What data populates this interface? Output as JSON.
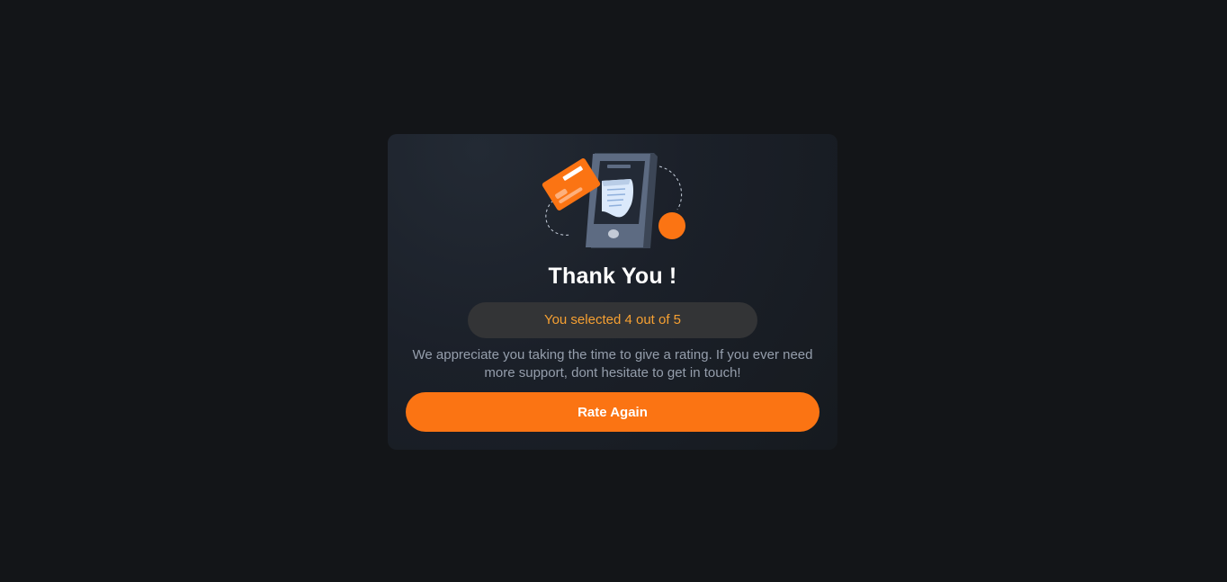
{
  "thank_you": {
    "title": "Thank You !",
    "selection_text": "You selected 4 out of 5",
    "message": "We appreciate you taking the time to give a rating. If you ever need more support, dont hesitate to get in touch!",
    "rate_again_label": "Rate Again",
    "rating": 4,
    "max_rating": 5
  },
  "colors": {
    "background": "#131518",
    "accent": "#fb7413",
    "badge_text": "#f6a032",
    "muted_text": "#959eac"
  },
  "icons": {
    "illustration": "phone-payment-illustration"
  }
}
